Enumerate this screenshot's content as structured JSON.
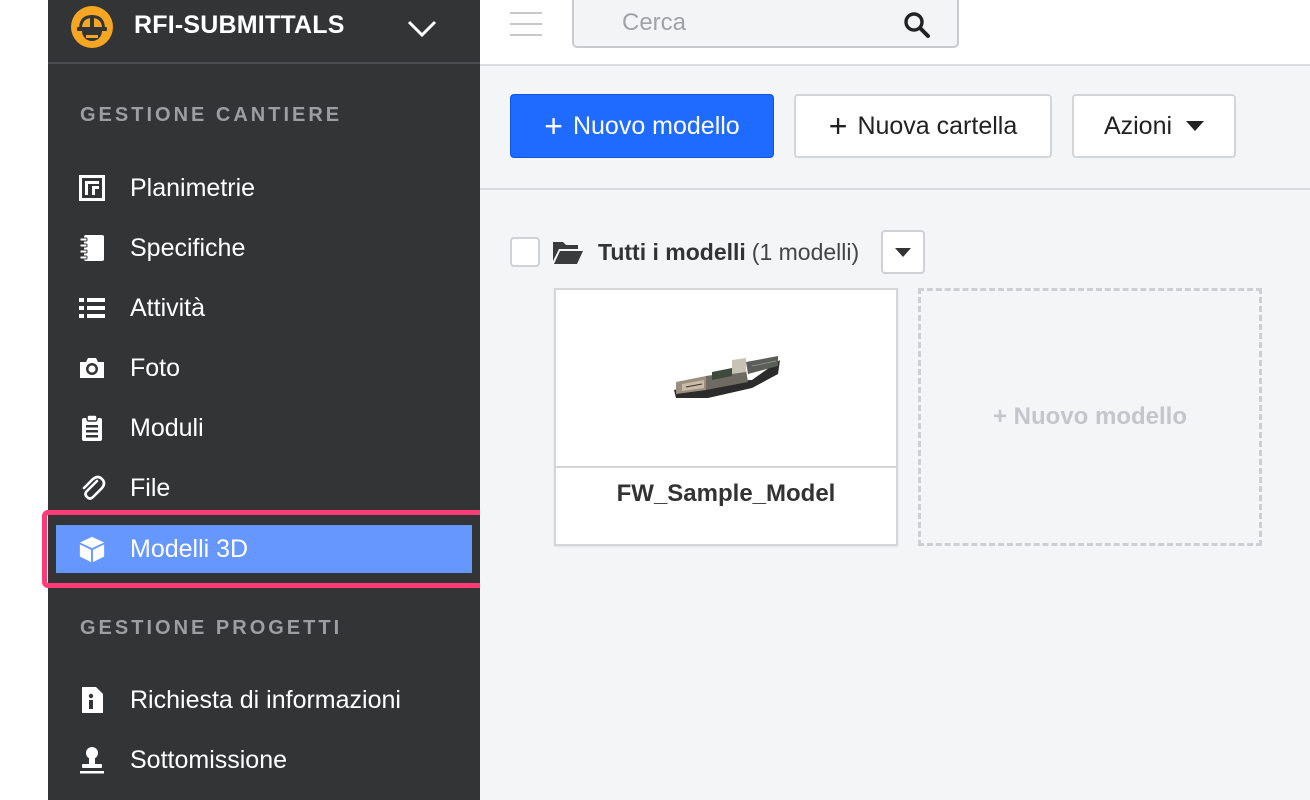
{
  "project": {
    "name": "RFI-SUBMITTALS"
  },
  "sidebar": {
    "sections": [
      {
        "label": "GESTIONE CANTIERE",
        "items": [
          {
            "label": "Planimetrie",
            "icon": "floorplan-icon"
          },
          {
            "label": "Specifiche",
            "icon": "notebook-icon"
          },
          {
            "label": "Attività",
            "icon": "list-icon"
          },
          {
            "label": "Foto",
            "icon": "camera-icon"
          },
          {
            "label": "Moduli",
            "icon": "clipboard-icon"
          },
          {
            "label": "File",
            "icon": "paperclip-icon"
          },
          {
            "label": "Modelli 3D",
            "icon": "cube-icon",
            "active": true
          }
        ]
      },
      {
        "label": "GESTIONE PROGETTI",
        "items": [
          {
            "label": "Richiesta di informazioni",
            "icon": "info-document-icon"
          },
          {
            "label": "Sottomissione",
            "icon": "stamp-icon"
          }
        ]
      }
    ]
  },
  "search": {
    "placeholder": "Cerca",
    "value": ""
  },
  "toolbar": {
    "new_model": "Nuovo modello",
    "new_folder": "Nuova cartella",
    "actions": "Azioni"
  },
  "folder": {
    "title": "Tutti i modelli",
    "count": "(1 modelli)"
  },
  "models": [
    {
      "name": "FW_Sample_Model"
    }
  ],
  "new_model_card": "+ Nuovo modello",
  "colors": {
    "sidebar_bg": "#333436",
    "active_item": "#6597ff",
    "highlight": "#ff3a74",
    "primary_button": "#1f6aff",
    "logo": "#f5a623"
  }
}
